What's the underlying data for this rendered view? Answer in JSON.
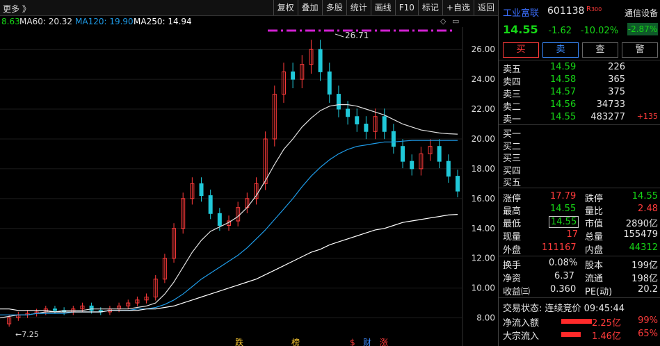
{
  "topbar": {
    "more": "更多 》",
    "buttons": [
      "复权",
      "叠加",
      "多股",
      "统计",
      "画线",
      "F10",
      "标记",
      "+自选",
      "返回"
    ]
  },
  "ma": {
    "first": "8.63",
    "ma60": "MA60: 20.32",
    "ma120": "MA120: 19.90",
    "ma250": "MA250: 14.94"
  },
  "chart": {
    "y_ticks": [
      "26.00",
      "24.00",
      "22.00",
      "20.00",
      "18.00",
      "16.00",
      "14.00",
      "12.00",
      "10.00",
      "8.00"
    ],
    "high_label": "26.71",
    "low_label": "←7.25",
    "markers": [
      "跌",
      "榜",
      "$",
      "财",
      "涨"
    ]
  },
  "chart_data": {
    "type": "line",
    "title": "",
    "xlabel": "",
    "ylabel": "",
    "ylim": [
      7.0,
      27.5
    ],
    "highest": 26.71,
    "lowest": 7.25,
    "series": [
      {
        "name": "Price",
        "values": [
          7.6,
          8.0,
          8.2,
          8.3,
          8.4,
          8.6,
          8.5,
          8.4,
          8.6,
          8.8,
          8.5,
          8.4,
          8.6,
          8.8,
          9.0,
          9.2,
          9.4,
          10.6,
          12.0,
          14.0,
          16.0,
          17.0,
          16.2,
          15.0,
          14.2,
          14.5,
          15.4,
          16.0,
          17.0,
          20.0,
          23.0,
          24.5,
          24.0,
          25.0,
          26.0,
          24.5,
          23.0,
          22.0,
          21.5,
          21.0,
          20.5,
          21.5,
          20.5,
          19.5,
          18.5,
          18.0,
          19.0,
          19.5,
          18.5,
          17.5,
          16.5
        ]
      },
      {
        "name": "MA60",
        "values": [
          8.0,
          8.1,
          8.2,
          8.2,
          8.3,
          8.4,
          8.4,
          8.5,
          8.5,
          8.5,
          8.6,
          8.6,
          8.6,
          8.6,
          8.6,
          8.7,
          8.8,
          9.0,
          9.6,
          10.4,
          11.4,
          12.4,
          13.2,
          13.8,
          14.1,
          14.4,
          14.8,
          15.4,
          16.2,
          17.2,
          18.3,
          19.3,
          20.0,
          20.8,
          21.4,
          21.9,
          22.2,
          22.3,
          22.3,
          22.2,
          22.0,
          21.8,
          21.6,
          21.3,
          21.0,
          20.8,
          20.6,
          20.5,
          20.4,
          20.35,
          20.32
        ]
      },
      {
        "name": "MA120",
        "values": [
          8.2,
          8.2,
          8.2,
          8.2,
          8.3,
          8.3,
          8.3,
          8.3,
          8.4,
          8.4,
          8.4,
          8.4,
          8.5,
          8.5,
          8.5,
          8.6,
          8.6,
          8.7,
          8.9,
          9.2,
          9.6,
          10.1,
          10.6,
          11.0,
          11.4,
          11.8,
          12.2,
          12.7,
          13.3,
          13.9,
          14.6,
          15.3,
          16.0,
          16.8,
          17.5,
          18.1,
          18.6,
          19.0,
          19.3,
          19.5,
          19.6,
          19.7,
          19.8,
          19.8,
          19.85,
          19.9,
          19.9,
          19.9,
          19.9,
          19.9,
          19.9
        ]
      },
      {
        "name": "MA250",
        "values": [
          8.6,
          8.6,
          8.5,
          8.5,
          8.5,
          8.5,
          8.4,
          8.4,
          8.4,
          8.4,
          8.4,
          8.4,
          8.5,
          8.5,
          8.5,
          8.5,
          8.6,
          8.6,
          8.7,
          8.8,
          9.0,
          9.2,
          9.4,
          9.6,
          9.8,
          10.0,
          10.2,
          10.4,
          10.6,
          10.9,
          11.2,
          11.5,
          11.8,
          12.1,
          12.4,
          12.6,
          12.9,
          13.1,
          13.3,
          13.5,
          13.7,
          13.9,
          14.0,
          14.2,
          14.4,
          14.5,
          14.6,
          14.7,
          14.8,
          14.9,
          14.94
        ]
      }
    ]
  },
  "stock": {
    "name": "工业富联",
    "code": "601138",
    "board": "R",
    "board_tag": "300",
    "industry": "通信设备",
    "price": "14.55",
    "change": "-1.62",
    "change_pct": "-10.02%",
    "industry_pct": "-2.87%",
    "buy": "买",
    "sell": "卖",
    "view": "查",
    "alert": "警"
  },
  "orderbook": {
    "asks": [
      {
        "label": "卖五",
        "price": "14.59",
        "vol": "226",
        "extra": ""
      },
      {
        "label": "卖四",
        "price": "14.58",
        "vol": "365",
        "extra": ""
      },
      {
        "label": "卖三",
        "price": "14.57",
        "vol": "375",
        "extra": ""
      },
      {
        "label": "卖二",
        "price": "14.56",
        "vol": "34733",
        "extra": ""
      },
      {
        "label": "卖一",
        "price": "14.55",
        "vol": "483277",
        "extra": "+135"
      }
    ],
    "bids": [
      {
        "label": "买一"
      },
      {
        "label": "买二"
      },
      {
        "label": "买三"
      },
      {
        "label": "买四"
      },
      {
        "label": "买五"
      }
    ]
  },
  "stats": {
    "limit_up_label": "涨停",
    "limit_up": "17.79",
    "limit_down_label": "跌停",
    "limit_down": "14.55",
    "high_label": "最高",
    "high": "14.55",
    "vol_ratio_label": "量比",
    "vol_ratio": "2.48",
    "low_label": "最低",
    "low": "14.55",
    "mcap_label": "市值",
    "mcap": "2890亿",
    "now_label": "现量",
    "now": "17",
    "total_label": "总量",
    "total": "155479",
    "outer_label": "外盘",
    "outer": "111167",
    "inner_label": "内盘",
    "inner": "44312",
    "turnover_label": "换手",
    "turnover": "0.08%",
    "equity_label": "股本",
    "equity": "199亿",
    "nav_label": "净资",
    "nav": "6.37",
    "float_label": "流通",
    "float": "198亿",
    "eps_label": "收益㈢",
    "eps": "0.360",
    "pe_label": "PE(动)",
    "pe": "20.2",
    "status": "交易状态: 连续竞价 09:45:44",
    "net_in_label": "净流入额",
    "net_in": "2.25亿",
    "net_in_pct": "99%",
    "block_in_label": "大宗流入",
    "block_in": "1.46亿",
    "block_in_pct": "65%"
  },
  "colors": {
    "up": "#ff3b3b",
    "down": "#16d616",
    "ma60": "#e0e0e0",
    "ma120": "#1e9be8",
    "ma250": "#ffffff"
  }
}
